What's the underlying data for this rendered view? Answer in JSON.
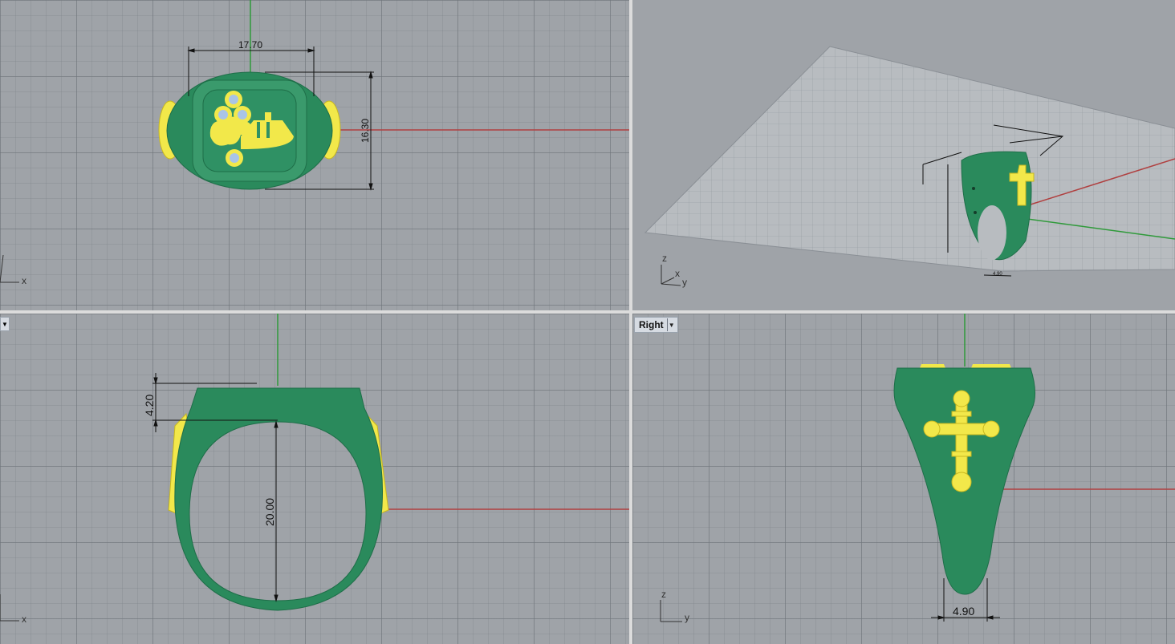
{
  "viewports": {
    "top": {
      "label": "",
      "axes": {
        "x": "x",
        "y": "y"
      },
      "dimensions": {
        "width": "17.70",
        "height": "16.30"
      }
    },
    "perspective": {
      "label": "",
      "axes": {
        "x": "x",
        "y": "y",
        "z": "z"
      },
      "dimensions": {
        "shank_width": "4.90"
      }
    },
    "front": {
      "label": "",
      "axes": {
        "x": "x",
        "z": "z"
      },
      "dimensions": {
        "top_height": "4.20",
        "inner_diameter": "20.00"
      }
    },
    "right": {
      "label": "Right",
      "axes": {
        "y": "y",
        "z": "z"
      },
      "dimensions": {
        "shank_width": "4.90"
      }
    }
  },
  "colors": {
    "background": "#9fa3a8",
    "ring_body": "#2a8a5c",
    "ring_ornament": "#f2e84a",
    "gem": "#a9c4e6",
    "axis_x": "#b04040",
    "axis_y": "#2f9a3a",
    "dimension_line": "#111111"
  }
}
